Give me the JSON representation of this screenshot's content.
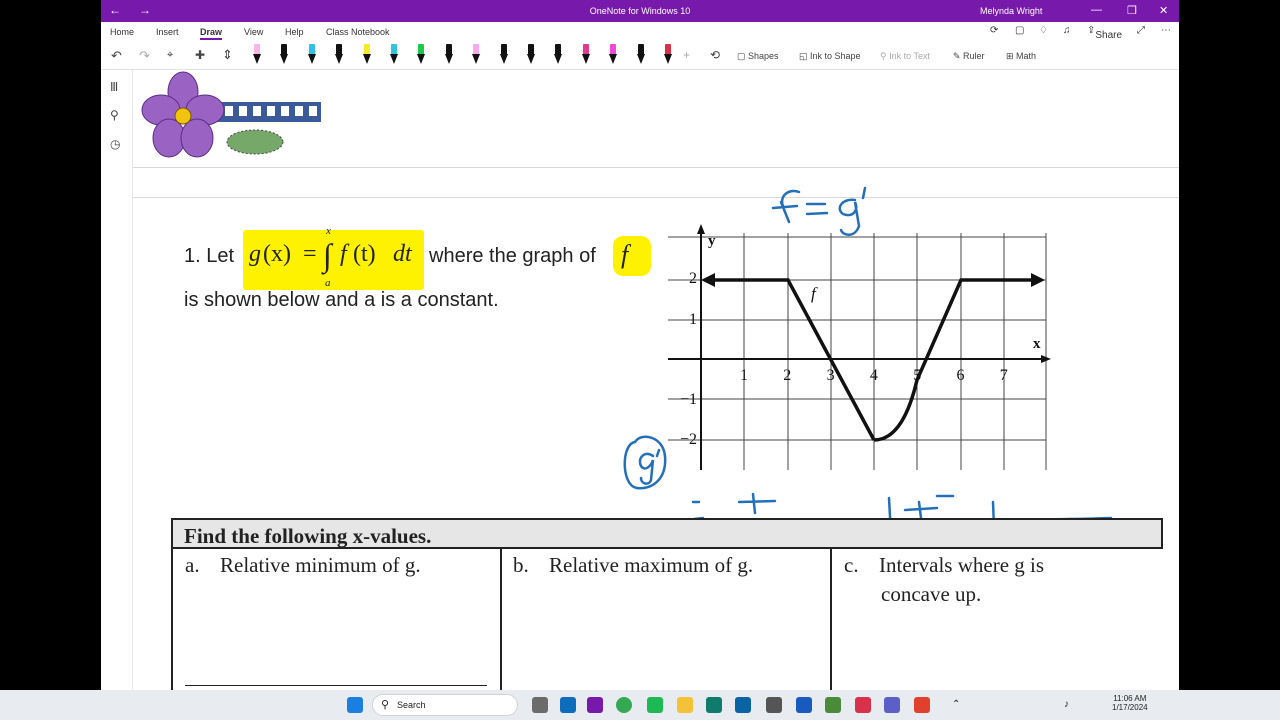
{
  "window": {
    "title": "OneNote for Windows 10",
    "user": "Melynda Wright",
    "back_icon": "←",
    "forward_icon": "→",
    "minimize_icon": "—",
    "maximize_icon": "❐",
    "close_icon": "✕"
  },
  "ribbon": {
    "tabs": [
      "Home",
      "Insert",
      "Draw",
      "View",
      "Help",
      "Class Notebook"
    ],
    "active_tab": "Draw",
    "share_label": "Share"
  },
  "toolbar": {
    "shapes_label": "Shapes",
    "ink_to_shape_label": "Ink to Shape",
    "ink_to_text_label": "Ink to Text",
    "ruler_label": "Ruler",
    "math_label": "Math",
    "pens": [
      "#f7b5e8",
      "#111111",
      "#2ec0e8",
      "#111111",
      "#f5ea2a",
      "#31c3e0",
      "#1ec84c",
      "#111111",
      "#f6a9ef",
      "#111111",
      "#111111",
      "#111111",
      "#e23a8f",
      "#ee49d8",
      "#111111",
      "#d9314b"
    ]
  },
  "question": {
    "prefix": "1. Let",
    "formula_g": "g",
    "formula_x": "(x)",
    "formula_eq": "=",
    "formula_int": "∫",
    "formula_upper": "x",
    "formula_lower": "a",
    "formula_f": "f",
    "formula_t": "(t)",
    "formula_dt": "dt",
    "middle": "where the graph of",
    "f_symbol": "f",
    "line2": "is shown below and a is a constant."
  },
  "graph": {
    "y_label": "y",
    "x_label": "x",
    "f_label": "f",
    "x_ticks": [
      "1",
      "2",
      "3",
      "4",
      "5",
      "6",
      "7"
    ],
    "y_ticks": [
      "2",
      "1",
      "−1",
      "−2"
    ]
  },
  "ink": {
    "f_eq_g": "f = g'",
    "g_prime": "g'",
    "plus1": "+",
    "minus": "−",
    "plus2": "+"
  },
  "table": {
    "header": "Find the following x-values.",
    "col_a_letter": "a.",
    "col_a_text": "Relative minimum of g.",
    "col_b_letter": "b.",
    "col_b_text": "Relative maximum of g.",
    "col_c_letter": "c.",
    "col_c_text1": "Intervals where g is",
    "col_c_text2": "concave up."
  },
  "taskbar": {
    "search_placeholder": "Search",
    "time": "11:06 AM",
    "date": "1/17/2024"
  }
}
